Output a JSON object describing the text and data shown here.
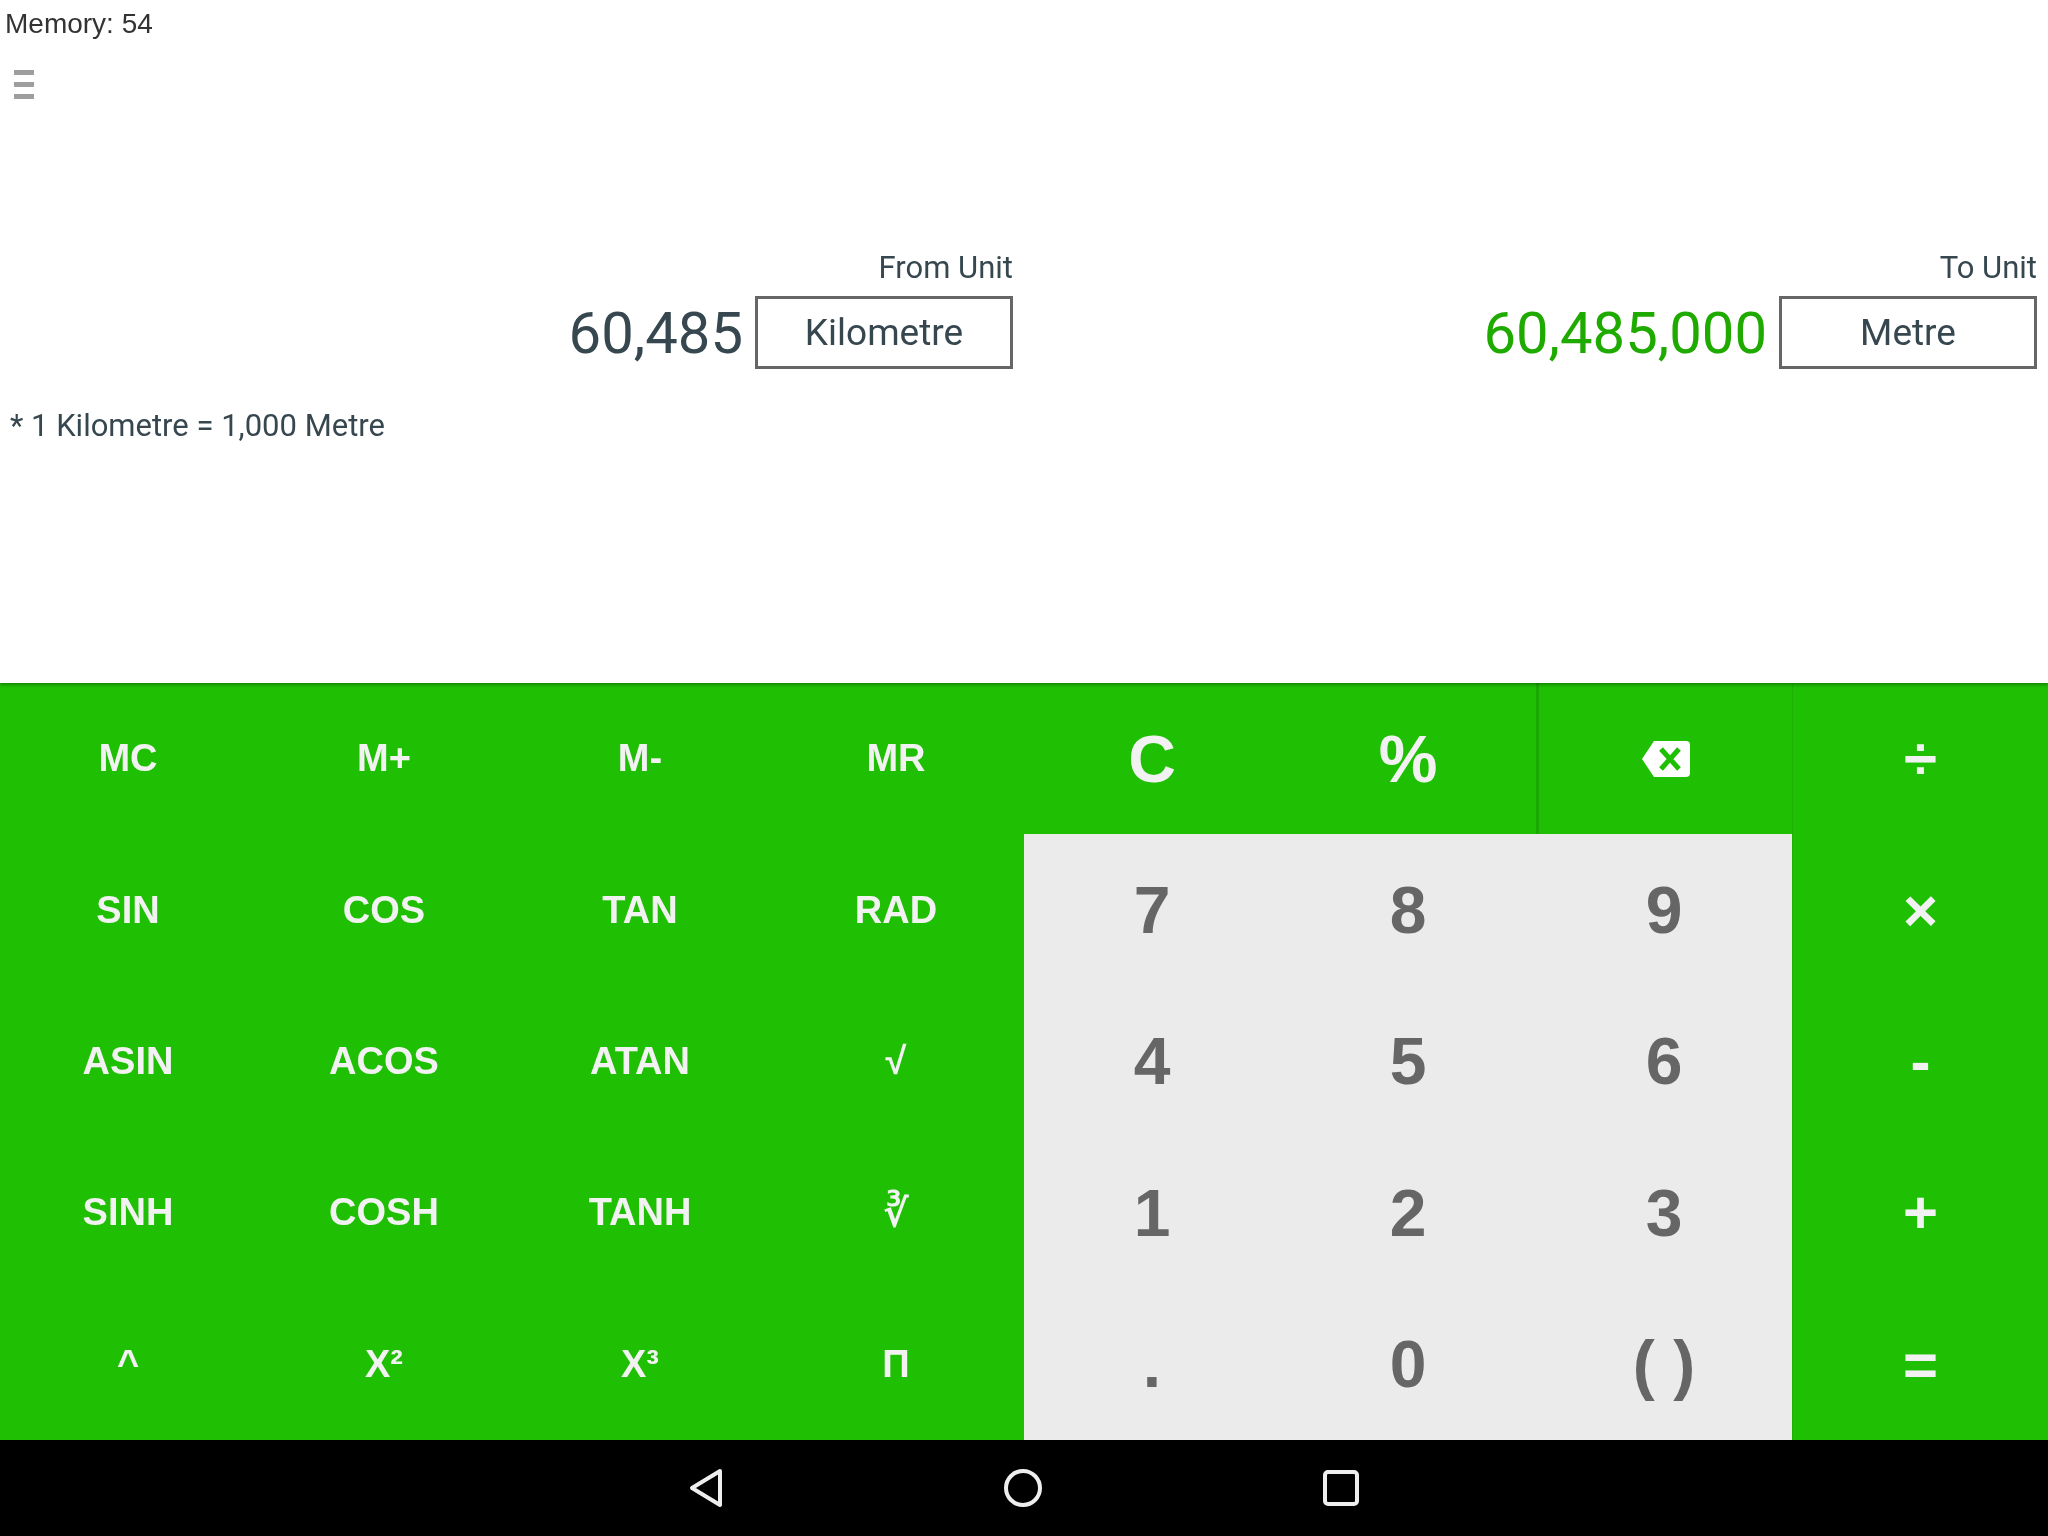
{
  "memory": "Memory: 54",
  "converter": {
    "from": {
      "label": "From Unit",
      "value": "60,485",
      "unit": "Kilometre"
    },
    "to": {
      "label": "To Unit",
      "value": "60,485,000",
      "unit": "Metre"
    },
    "note": "* 1 Kilometre = 1,000 Metre"
  },
  "keypad": [
    [
      {
        "kind": "function",
        "label": "MC"
      },
      {
        "kind": "function",
        "label": "M+"
      },
      {
        "kind": "function",
        "label": "M-"
      },
      {
        "kind": "function",
        "label": "MR"
      },
      {
        "kind": "large",
        "label": "C"
      },
      {
        "kind": "large",
        "label": "%"
      },
      {
        "kind": "backspace"
      },
      {
        "kind": "operator",
        "label": "÷"
      }
    ],
    [
      {
        "kind": "function",
        "label": "SIN"
      },
      {
        "kind": "function",
        "label": "COS"
      },
      {
        "kind": "function",
        "label": "TAN"
      },
      {
        "kind": "function",
        "label": "RAD"
      },
      {
        "kind": "digit",
        "label": "7"
      },
      {
        "kind": "digit",
        "label": "8"
      },
      {
        "kind": "digit",
        "label": "9"
      },
      {
        "kind": "operator",
        "label": "×"
      }
    ],
    [
      {
        "kind": "function",
        "label": "ASIN"
      },
      {
        "kind": "function",
        "label": "ACOS"
      },
      {
        "kind": "function",
        "label": "ATAN"
      },
      {
        "kind": "function",
        "label": "√"
      },
      {
        "kind": "digit",
        "label": "4"
      },
      {
        "kind": "digit",
        "label": "5"
      },
      {
        "kind": "digit",
        "label": "6"
      },
      {
        "kind": "operator",
        "label": "-"
      }
    ],
    [
      {
        "kind": "function",
        "label": "SINH"
      },
      {
        "kind": "function",
        "label": "COSH"
      },
      {
        "kind": "function",
        "label": "TANH"
      },
      {
        "kind": "function",
        "label": "∛"
      },
      {
        "kind": "digit",
        "label": "1"
      },
      {
        "kind": "digit",
        "label": "2"
      },
      {
        "kind": "digit",
        "label": "3"
      },
      {
        "kind": "operator",
        "label": "+"
      }
    ],
    [
      {
        "kind": "function",
        "label": "^"
      },
      {
        "kind": "function",
        "label": "X²"
      },
      {
        "kind": "function",
        "label": "X³"
      },
      {
        "kind": "function",
        "label": "Π"
      },
      {
        "kind": "digit",
        "label": "."
      },
      {
        "kind": "digit",
        "label": "0"
      },
      {
        "kind": "digit",
        "label": "( )"
      },
      {
        "kind": "operator",
        "label": "="
      }
    ]
  ]
}
